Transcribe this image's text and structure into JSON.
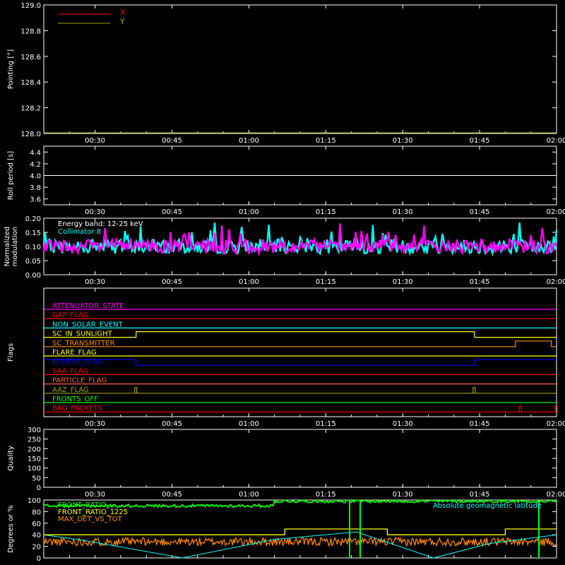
{
  "colors": {
    "background": "#000000",
    "axes": "#ffffff",
    "red": "#ff0000",
    "olive": "#a0a000",
    "magenta": "#ff00ff",
    "cyan": "#00ffff",
    "yellow": "#ffff00",
    "orange": "#ff8800",
    "blue": "#0000ff",
    "green": "#00ff00",
    "salmon": "#ff6040",
    "white": "#ffffff"
  },
  "chart_data": [
    {
      "id": "pointing",
      "type": "line",
      "ylabel": "Pointing [°]",
      "ylim": [
        128.0,
        129.0
      ],
      "yticks": [
        "128.0",
        "128.2",
        "128.4",
        "128.6",
        "128.8",
        "129.0"
      ],
      "xticks": [
        "00:30",
        "00:45",
        "01:00",
        "01:15",
        "01:30",
        "01:45",
        "02:00"
      ],
      "legend": [
        {
          "name": "X",
          "color": "red"
        },
        {
          "name": "Y",
          "color": "olive"
        }
      ],
      "series": [
        {
          "name": "X",
          "color": "red",
          "values": []
        },
        {
          "name": "Y",
          "color": "olive",
          "values": [
            128.0,
            128.0
          ]
        }
      ]
    },
    {
      "id": "roll",
      "type": "line",
      "ylabel": "Roll period [s]",
      "ylim": [
        3.5,
        4.5
      ],
      "yticks": [
        "3.6",
        "3.8",
        "4.0",
        "4.2",
        "4.4"
      ],
      "xticks": [
        "00:30",
        "00:45",
        "01:00",
        "01:15",
        "01:30",
        "01:45",
        "02:00"
      ],
      "series": [
        {
          "name": "roll",
          "color": "white",
          "value": 4.0
        }
      ]
    },
    {
      "id": "modulation",
      "type": "line",
      "ylabel_lines": [
        "Normalized",
        "modulation"
      ],
      "ylim": [
        0.0,
        0.2
      ],
      "yticks": [
        "0.00",
        "0.05",
        "0.10",
        "0.15",
        "0.20"
      ],
      "xticks": [
        "00:30",
        "00:45",
        "01:00",
        "01:15",
        "01:30",
        "01:45",
        "02:00"
      ],
      "annotations": [
        "Energy band: 12-25 keV",
        "Collimator 8"
      ],
      "series": [
        {
          "name": "cyan trace",
          "color": "cyan",
          "mean": 0.1
        },
        {
          "name": "magenta trace",
          "color": "magenta",
          "mean": 0.1
        }
      ]
    },
    {
      "id": "flags",
      "type": "line",
      "ylabel": "Flags",
      "xticks": [
        "00:30",
        "00:45",
        "01:00",
        "01:15",
        "01:30",
        "01:45",
        "02:00"
      ],
      "flags": [
        {
          "name": "ATTENUATOR_STATE",
          "color": "magenta",
          "steps": []
        },
        {
          "name": "GAP_FLAG",
          "color": "red",
          "steps": []
        },
        {
          "name": "NON_SOLAR_EVENT",
          "color": "cyan",
          "steps": []
        },
        {
          "name": "SC_IN_SUNLIGHT",
          "color": "yellow",
          "steps": [
            [
              "00:00",
              0
            ],
            [
              "00:38",
              1
            ],
            [
              "01:44",
              0
            ]
          ]
        },
        {
          "name": "SC_TRANSMITTER",
          "color": "orange",
          "steps": [
            [
              "00:00",
              0
            ],
            [
              "01:52",
              1
            ],
            [
              "01:59",
              0
            ]
          ]
        },
        {
          "name": "FLARE_FLAG",
          "color": "yellow",
          "steps": []
        },
        {
          "name": "ECLIPSE_FLAG",
          "color": "blue",
          "steps": [
            [
              "00:00",
              1
            ],
            [
              "00:38",
              0
            ],
            [
              "01:44",
              1
            ]
          ]
        },
        {
          "name": "SAA_FLAG",
          "color": "red",
          "steps": []
        },
        {
          "name": "PARTICLE_FLAG",
          "color": "salmon",
          "steps": []
        },
        {
          "name": "AAZ_FLAG",
          "color": "olive",
          "pulses": [
            "00:38",
            "01:44"
          ]
        },
        {
          "name": "FRONTS_OFF",
          "color": "green",
          "steps": []
        },
        {
          "name": "BAD_PACKETS",
          "color": "red",
          "pulses": [
            "01:53",
            "02:00"
          ]
        }
      ]
    },
    {
      "id": "quality",
      "type": "line",
      "ylabel": "Quality",
      "ylim": [
        0,
        300
      ],
      "yticks": [
        "0",
        "50",
        "100",
        "150",
        "200",
        "250",
        "300"
      ],
      "xticks": [
        "00:30",
        "00:45",
        "01:00",
        "01:15",
        "01:30",
        "01:45",
        "02:00"
      ],
      "series": [
        {
          "name": "quality",
          "color": "white",
          "value": 0
        }
      ]
    },
    {
      "id": "ratios",
      "type": "line",
      "ylabel": "Degrees or %",
      "ylim": [
        0,
        100
      ],
      "yticks": [
        "0",
        "20",
        "40",
        "60",
        "80",
        "100"
      ],
      "legend": [
        {
          "name": "FRONT_RATIO_...",
          "color": "green"
        },
        {
          "name": "FRONT_RATIO_1225",
          "color": "yellow"
        },
        {
          "name": "MAX_DET_VS_TOT",
          "color": "orange"
        },
        {
          "name": "Absolute geomagnetic latitude",
          "color": "cyan"
        }
      ],
      "series": [
        {
          "name": "FRONT_RATIO_...",
          "color": "green",
          "level_before": 90,
          "level_after": 98
        },
        {
          "name": "FRONT_RATIO_1225",
          "color": "yellow",
          "steps": [
            [
              "00:20",
              40
            ],
            [
              "01:07",
              50
            ],
            [
              "01:27",
              40
            ],
            [
              "01:50",
              50
            ]
          ]
        },
        {
          "name": "MAX_DET_VS_TOT",
          "color": "orange",
          "mean": 28
        },
        {
          "name": "Absolute geomagnetic latitude",
          "color": "cyan",
          "points": [
            [
              "00:20",
              40
            ],
            [
              "00:28",
              30
            ],
            [
              "00:47",
              0
            ],
            [
              "01:05",
              32
            ],
            [
              "01:21",
              45
            ],
            [
              "01:36",
              0
            ],
            [
              "01:47",
              25
            ],
            [
              "02:00",
              40
            ]
          ]
        }
      ]
    }
  ]
}
